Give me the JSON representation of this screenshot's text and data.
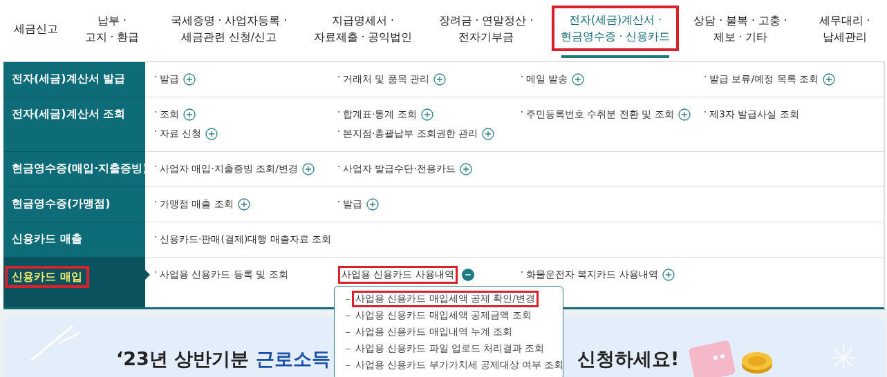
{
  "nav": [
    {
      "lines": [
        "세금신고"
      ],
      "selected": false,
      "highlighted": false
    },
    {
      "lines": [
        "납부 ·",
        "고지 · 환급"
      ],
      "selected": false,
      "highlighted": false
    },
    {
      "lines": [
        "국세증명 · 사업자등록 ·",
        "세금관련 신청/신고"
      ],
      "selected": false,
      "highlighted": false
    },
    {
      "lines": [
        "지급명세서 ·",
        "자료제출 · 공익법인"
      ],
      "selected": false,
      "highlighted": false
    },
    {
      "lines": [
        "장려금 · 연말정산 ·",
        "전자기부금"
      ],
      "selected": false,
      "highlighted": false
    },
    {
      "lines": [
        "전자(세금)계산서 ·",
        "현금영수증 · 신용카드"
      ],
      "selected": true,
      "highlighted": true
    },
    {
      "lines": [
        "상담 · 불복 · 고충 ·",
        "제보 · 기타"
      ],
      "selected": false,
      "highlighted": false
    },
    {
      "lines": [
        "세무대리 ·",
        "납세관리"
      ],
      "selected": false,
      "highlighted": false
    }
  ],
  "menu": [
    {
      "label": "전자(세금)계산서 발급",
      "selected": false,
      "highlighted": false,
      "items": [
        {
          "label": "발급",
          "expanded": false
        },
        {
          "label": "거래처 및 품목 관리",
          "expanded": false
        },
        {
          "label": "메일 발송",
          "expanded": false
        },
        {
          "label": "발급 보류/예정 목록 조회",
          "expanded": false
        }
      ]
    },
    {
      "label": "전자(세금)계산서 조회",
      "selected": false,
      "highlighted": false,
      "items": [
        {
          "label": "조회",
          "expanded": false
        },
        {
          "label": "합계표·통계 조회",
          "expanded": false
        },
        {
          "label": "주민등록번호 수취분 전환 및 조회",
          "expanded": false
        },
        {
          "label": "제3자 발급사실 조회"
        },
        {
          "label": "자료 신청",
          "expanded": false
        },
        {
          "label": "본지점·총괄납부 조회권한 관리",
          "expanded": false
        }
      ]
    },
    {
      "label": "현금영수증(매입·지출증빙)",
      "selected": false,
      "highlighted": false,
      "items": [
        {
          "label": "사업자 매입·지출증빙 조회/변경",
          "expanded": false
        },
        {
          "label": "사업자 발급수단·전용카드",
          "expanded": false
        }
      ]
    },
    {
      "label": "현금영수증(가맹점)",
      "selected": false,
      "highlighted": false,
      "items": [
        {
          "label": "가맹점 매출 조회",
          "expanded": false
        },
        {
          "label": "발급",
          "expanded": false
        }
      ]
    },
    {
      "label": "신용카드 매출",
      "selected": false,
      "highlighted": false,
      "items": [
        {
          "label": "신용카드·판매(결제)대행 매출자료 조회"
        }
      ]
    },
    {
      "label": "신용카드 매입",
      "selected": true,
      "highlighted": true,
      "items": [
        {
          "label": "사업용 신용카드 등록 및 조회"
        },
        {
          "label": "사업용 신용카드 사용내역",
          "expanded": true,
          "highlighted": true,
          "children": [
            {
              "label": "사업용 신용카드 매입세액 공제 확인/변경",
              "highlighted": true
            },
            {
              "label": "사업용 신용카드 매입세액 공제금액 조회",
              "highlighted": false
            },
            {
              "label": "사업용 신용카드 매입내역 누계 조회",
              "highlighted": false
            },
            {
              "label": "사업용 신용카드 파일 업로드 처리결과 조회",
              "highlighted": false
            },
            {
              "label": "사업용 신용카드 부가가치세 공제대상 여부 조회",
              "highlighted": false
            }
          ]
        },
        {
          "label": "화물운전자 복지카드 사용내역",
          "expanded": false
        }
      ]
    }
  ],
  "banner": {
    "title_start": "‘23년 상반기분 ",
    "title_highlight": "근로소득",
    "title_end": "신청하세요!"
  }
}
